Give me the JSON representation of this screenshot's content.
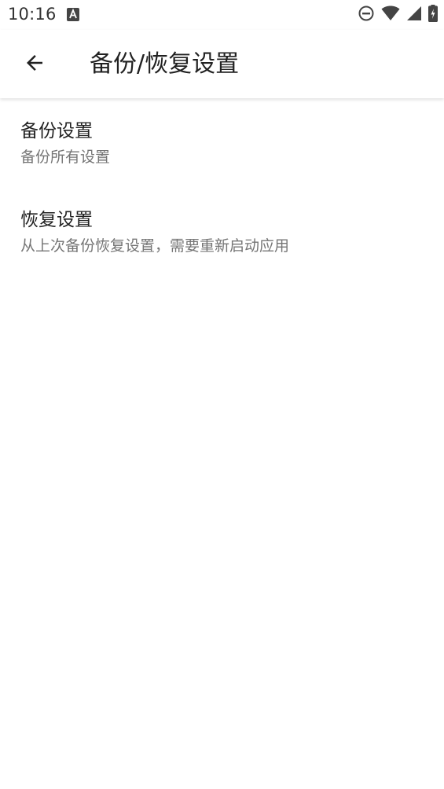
{
  "status_bar": {
    "time": "10:16",
    "notification_icon": "font-a-icon",
    "icons": [
      "do-not-disturb-icon",
      "wifi-icon",
      "cell-signal-icon",
      "battery-charging-icon"
    ]
  },
  "toolbar": {
    "back_icon": "arrow-back-icon",
    "title": "备份/恢复设置"
  },
  "preferences": [
    {
      "title": "备份设置",
      "summary": "备份所有设置"
    },
    {
      "title": "恢复设置",
      "summary": "从上次备份恢复设置，需要重新启动应用"
    }
  ],
  "colors": {
    "title_text": "#212121",
    "summary_text": "#757575",
    "icon": "#333333",
    "background": "#ffffff"
  }
}
